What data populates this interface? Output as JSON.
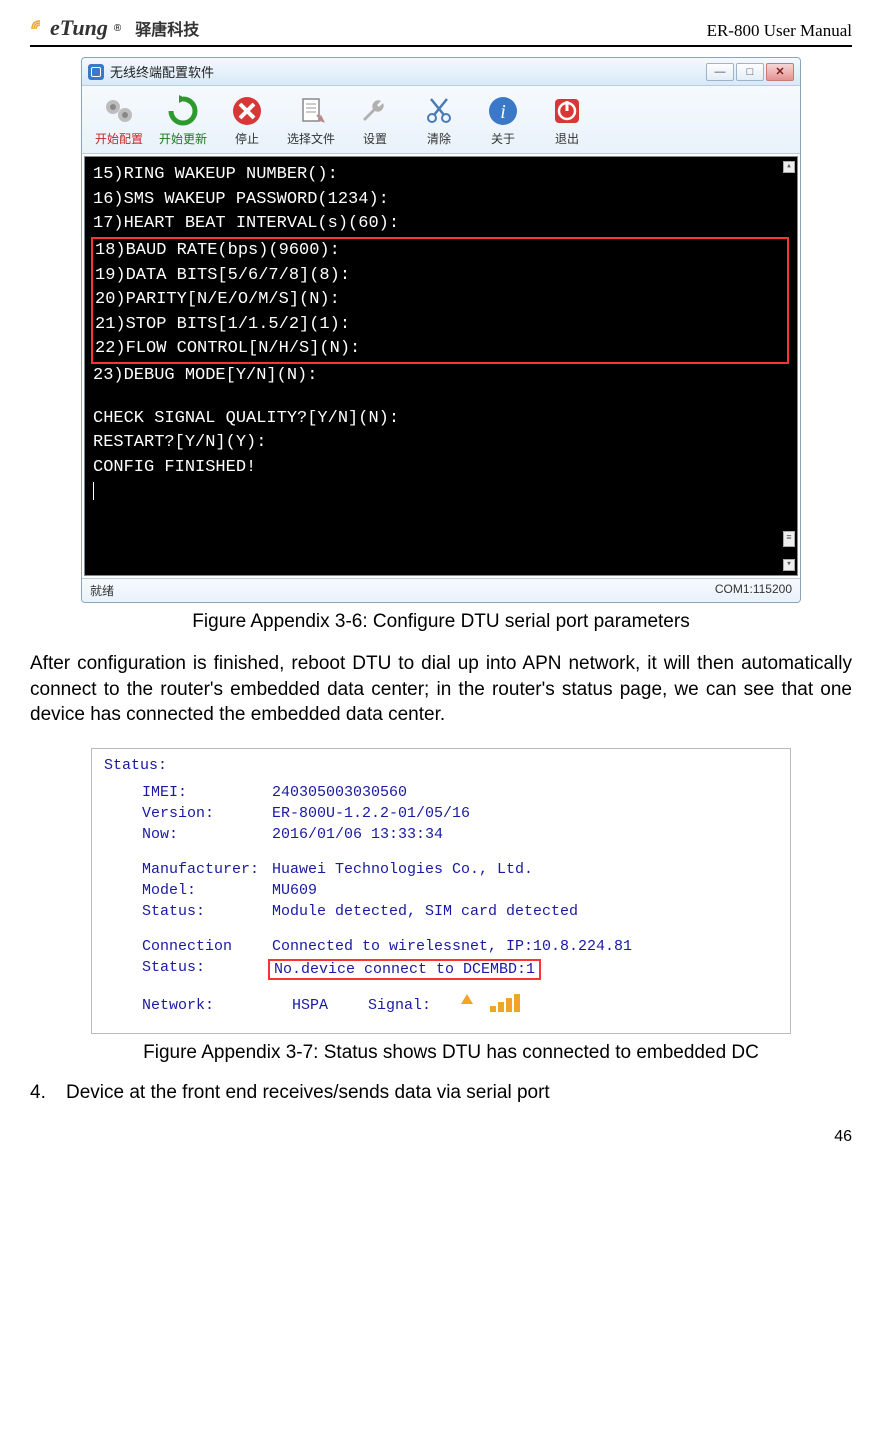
{
  "header": {
    "logo_text": "eTung",
    "logo_cn": "驿唐科技",
    "doc_title": "ER-800 User Manual"
  },
  "app1": {
    "window_title": "无线终端配置软件",
    "toolbar": {
      "t0": "开始配置",
      "t1": "开始更新",
      "t2": "停止",
      "t3": "选择文件",
      "t4": "设置",
      "t5": "清除",
      "t6": "关于",
      "t7": "退出"
    },
    "terminal": {
      "l0": "15)RING WAKEUP NUMBER():",
      "l1": "16)SMS WAKEUP PASSWORD(1234):",
      "l2": "17)HEART BEAT INTERVAL(s)(60):",
      "box_l0": "18)BAUD RATE(bps)(9600):",
      "box_l1": "19)DATA BITS[5/6/7/8](8):",
      "box_l2": "20)PARITY[N/E/O/M/S](N):",
      "box_l3": "21)STOP BITS[1/1.5/2](1):",
      "box_l4": "22)FLOW CONTROL[N/H/S](N):",
      "l3": "23)DEBUG MODE[Y/N](N):",
      "l4": "CHECK SIGNAL QUALITY?[Y/N](N):",
      "l5": "RESTART?[Y/N](Y):",
      "l6": "CONFIG FINISHED!"
    },
    "status_left": "就绪",
    "status_right": "COM1:115200"
  },
  "captions": {
    "fig36": "Figure Appendix 3-6: Configure DTU serial port parameters",
    "fig37": "Figure Appendix 3-7: Status shows DTU has connected to embedded DC"
  },
  "body": {
    "para1": "After configuration is finished, reboot DTU to dial up into APN network, it will then automatically connect to the router's embedded data center; in the router's status page, we can see that one device has connected the embedded data center."
  },
  "status_panel": {
    "title": "Status:",
    "rows": {
      "imei_label": "IMEI:",
      "imei_val": "240305003030560",
      "version_label": "Version:",
      "version_val": "ER-800U-1.2.2-01/05/16",
      "now_label": "Now:",
      "now_val": "2016/01/06 13:33:34",
      "mfr_label": "Manufacturer:",
      "mfr_val": "Huawei Technologies Co., Ltd.",
      "model_label": "Model:",
      "model_val": "MU609",
      "status_label": "Status:",
      "status_val": "Module detected, SIM card detected",
      "conn_label": "Connection",
      "conn_val": "Connected to wirelessnet, IP:10.8.224.81",
      "status2_label": "Status:",
      "status2_val": "No.device connect to DCEMBD:1",
      "network_label": "Network:",
      "network_val": "HSPA",
      "signal_label": "Signal:"
    }
  },
  "list": {
    "num": "4.",
    "item": "Device at the front end receives/sends data via serial port"
  },
  "page_number": "46"
}
